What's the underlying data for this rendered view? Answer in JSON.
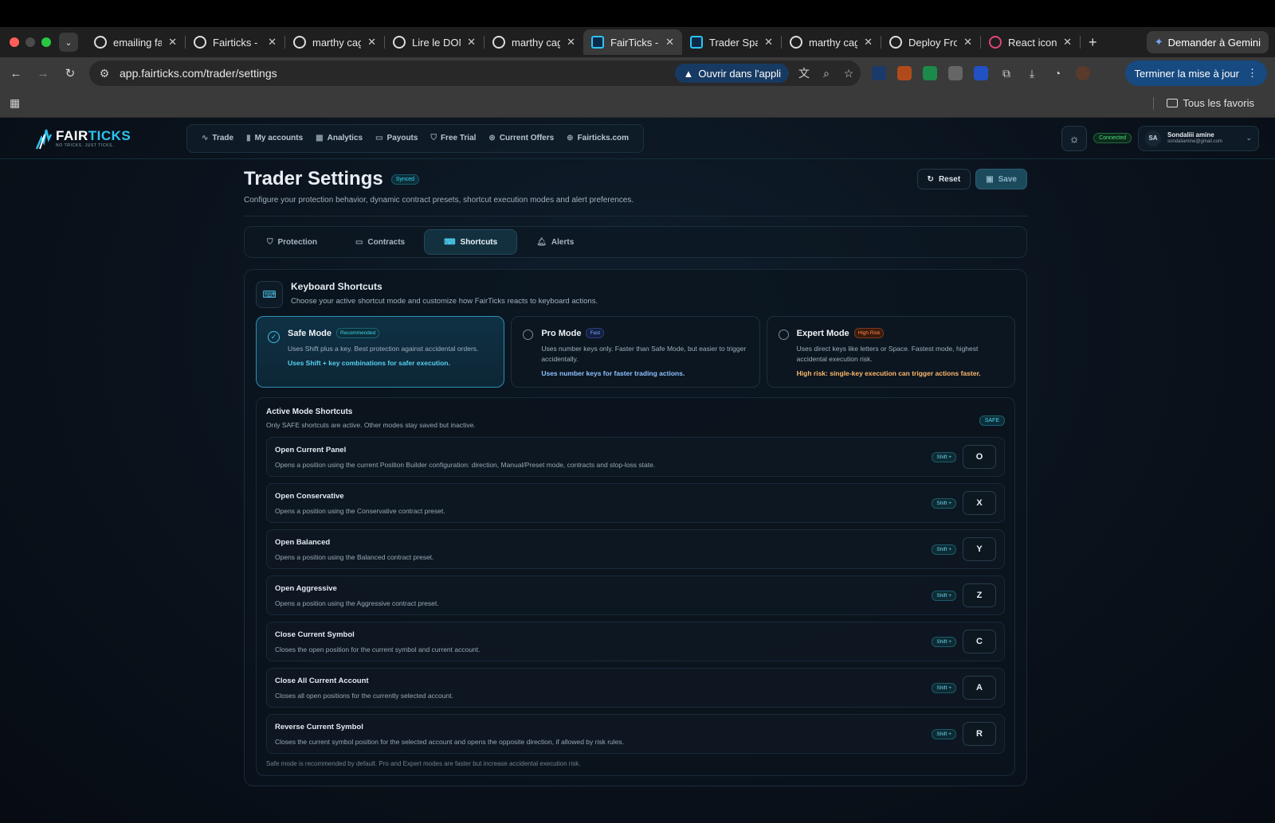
{
  "browser": {
    "tabs": [
      {
        "title": "emailing fai",
        "active": false
      },
      {
        "title": "Fairticks - F",
        "active": false
      },
      {
        "title": "marthy cag",
        "active": false
      },
      {
        "title": "Lire le DOM",
        "active": false
      },
      {
        "title": "marthy cag",
        "active": false
      },
      {
        "title": "FairTicks - I",
        "active": true
      },
      {
        "title": "Trader Spac",
        "active": false
      },
      {
        "title": "marthy cag",
        "active": false
      },
      {
        "title": "Deploy Fror",
        "active": false
      },
      {
        "title": "React icons",
        "active": false
      }
    ],
    "gemini_label": "Demander à Gemini",
    "url": "app.fairticks.com/trader/settings",
    "open_app_label": "Ouvrir dans l'appli",
    "update_label": "Terminer la mise à jour",
    "favorites_label": "Tous les favoris"
  },
  "header": {
    "logo_name_a": "FAIR",
    "logo_name_b": "TICKS",
    "logo_tagline": "NO TRICKS. JUST TICKS.",
    "nav": [
      "Trade",
      "My accounts",
      "Analytics",
      "Payouts",
      "Free Trial",
      "Current Offers",
      "Fairticks.com"
    ],
    "status": "Connected",
    "user_initials": "SA",
    "user_name": "Sondaliii amine",
    "user_email": "sondaliamine@gmail.com"
  },
  "page": {
    "title": "Trader Settings",
    "synced_badge": "Synced",
    "reset_label": "Reset",
    "save_label": "Save",
    "subtitle": "Configure your protection behavior, dynamic contract presets, shortcut execution modes and alert preferences."
  },
  "settings_tabs": [
    {
      "label": "Protection",
      "active": false
    },
    {
      "label": "Contracts",
      "active": false
    },
    {
      "label": "Shortcuts",
      "active": true
    },
    {
      "label": "Alerts",
      "active": false
    }
  ],
  "shortcuts": {
    "title": "Keyboard Shortcuts",
    "description": "Choose your active shortcut mode and customize how FairTicks reacts to keyboard actions.",
    "modes": [
      {
        "title": "Safe Mode",
        "badge": "Recommended",
        "desc": "Uses Shift plus a key. Best protection against accidental orders.",
        "note": "Uses Shift + key combinations for safer execution.",
        "selected": true
      },
      {
        "title": "Pro Mode",
        "badge": "Fast",
        "desc": "Uses number keys only. Faster than Safe Mode, but easier to trigger accidentally.",
        "note": "Uses number keys for faster trading actions.",
        "selected": false
      },
      {
        "title": "Expert Mode",
        "badge": "High Risk",
        "desc": "Uses direct keys like letters or Space. Fastest mode, highest accidental execution risk.",
        "note": "High risk: single-key execution can trigger actions faster.",
        "selected": false
      }
    ],
    "active_title": "Active Mode Shortcuts",
    "active_desc": "Only SAFE shortcuts are active. Other modes stay saved but inactive.",
    "active_badge": "SAFE",
    "modifier_label": "Shift +",
    "rows": [
      {
        "title": "Open Current Panel",
        "desc": "Opens a position using the current Position Builder configuration: direction, Manual/Preset mode, contracts and stop-loss state.",
        "key": "O"
      },
      {
        "title": "Open Conservative",
        "desc": "Opens a position using the Conservative contract preset.",
        "key": "X"
      },
      {
        "title": "Open Balanced",
        "desc": "Opens a position using the Balanced contract preset.",
        "key": "Y"
      },
      {
        "title": "Open Aggressive",
        "desc": "Opens a position using the Aggressive contract preset.",
        "key": "Z"
      },
      {
        "title": "Close Current Symbol",
        "desc": "Closes the open position for the current symbol and current account.",
        "key": "C"
      },
      {
        "title": "Close All Current Account",
        "desc": "Closes all open positions for the currently selected account.",
        "key": "A"
      },
      {
        "title": "Reverse Current Symbol",
        "desc": "Closes the current symbol position for the selected account and opens the opposite direction, if allowed by risk rules.",
        "key": "R"
      }
    ],
    "footer": "Safe mode is recommended by default. Pro and Expert modes are faster but increase accidental execution risk."
  }
}
